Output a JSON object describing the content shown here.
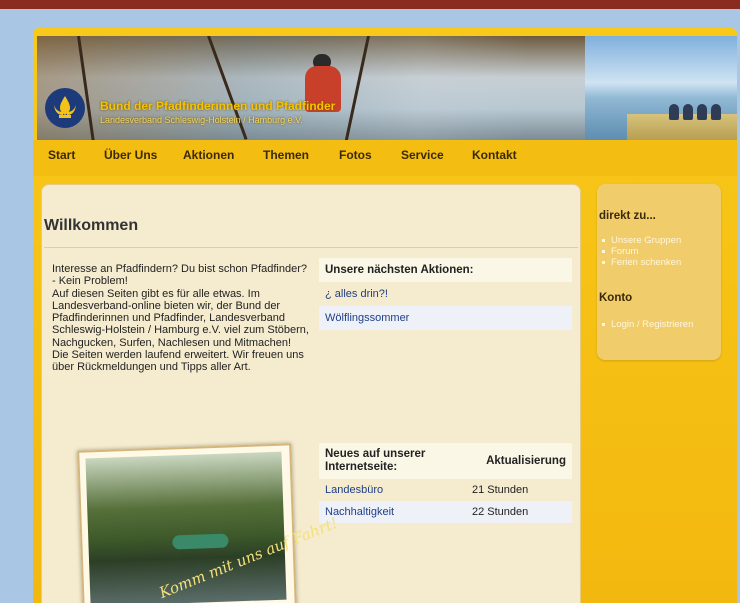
{
  "brand": {
    "title": "Bund der Pfadfinderinnen und Pfadfinder",
    "subtitle": "Landesverband Schleswig-Holstein / Hamburg e.V."
  },
  "nav": [
    "Start",
    "Über Uns",
    "Aktionen",
    "Themen",
    "Fotos",
    "Service",
    "Kontakt"
  ],
  "main": {
    "title": "Willkommen",
    "intro": "Interesse an Pfadfindern? Du bist schon Pfadfinder? - Kein Problem!\nAuf diesen Seiten gibt es für alle etwas. Im Landesverband-online bieten wir, der Bund der Pfadfinderinnen und Pfadfinder, Landesverband Schleswig-Holstein / Hamburg e.V. viel zum Stöbern, Nachgucken, Surfen, Nachlesen und Mitmachen!\nDie Seiten werden laufend erweitert. Wir freuen uns über Rückmeldungen und Tipps aller Art."
  },
  "actions": {
    "header": "Unsere nächsten Aktionen:",
    "items": [
      "¿ alles drin?!",
      "Wölflingssommer"
    ]
  },
  "news": {
    "header_left": "Neues auf unserer Internetseite:",
    "header_right": "Aktualisierung",
    "rows": [
      {
        "page": "Landesbüro",
        "updated": "21 Stunden"
      },
      {
        "page": "Nachhaltigkeit",
        "updated": "22 Stunden"
      }
    ]
  },
  "photo": {
    "caption": "Komm mit uns auf Fahrt!"
  },
  "sidebar": {
    "direkt_title": "direkt zu...",
    "direkt_links": [
      "Unsere Gruppen",
      "Forum",
      "Ferien schenken"
    ],
    "konto_title": "Konto",
    "konto_links": [
      "Login / Registrieren"
    ]
  }
}
